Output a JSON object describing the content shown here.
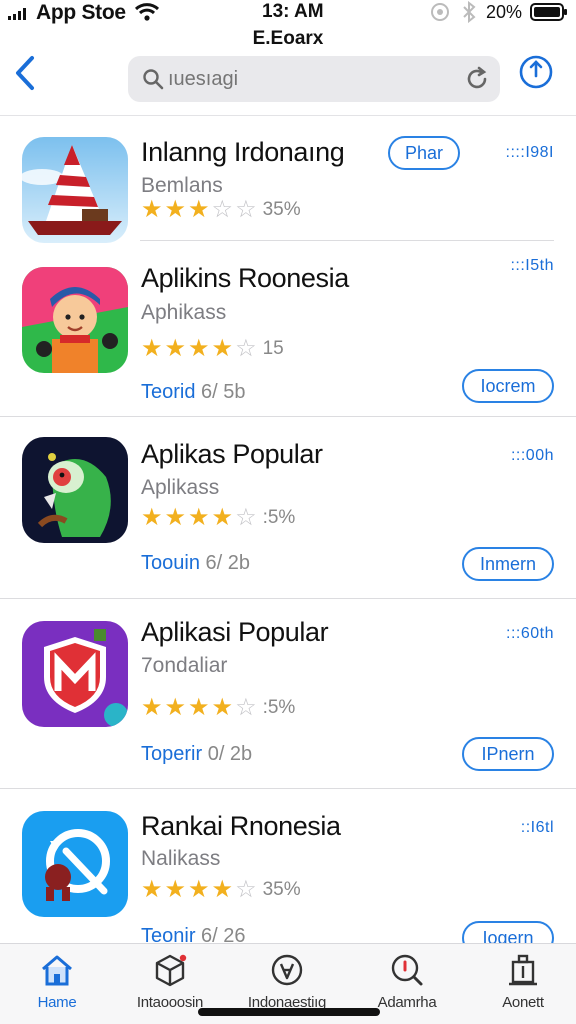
{
  "status": {
    "carrier": "App Stoe",
    "time": "13: AM",
    "battery_pct": "20%"
  },
  "header": {
    "title": "E.Eoarx"
  },
  "search": {
    "placeholder": "ıuesıagi"
  },
  "apps": [
    {
      "name": "Inlanng Irdonaıng",
      "subtitle": "Bemlans",
      "rating_text": "35%",
      "stars": 3,
      "size": "::::I98I",
      "action_label": "Phar",
      "meta": "",
      "meta_grey": ""
    },
    {
      "name": "Aplikins Roonesia",
      "subtitle": "Aphikass",
      "rating_text": "15",
      "stars": 4,
      "size": ":::I5th",
      "action_label": "Iocrem",
      "meta": "Teorid",
      "meta_grey": " 6/ 5b"
    },
    {
      "name": "Aplikas Popular",
      "subtitle": "Aplikass",
      "rating_text": ":5%",
      "stars": 4,
      "size": ":::00h",
      "action_label": "Inmern",
      "meta": "Toouin",
      "meta_grey": " 6/ 2b"
    },
    {
      "name": "Aplikasi Popular",
      "subtitle": "7ondaliar",
      "rating_text": ":5%",
      "stars": 4,
      "size": ":::60th",
      "action_label": "IPnern",
      "meta": "Toperir",
      "meta_grey": " 0/ 2b"
    },
    {
      "name": "Rankai Rnonesia",
      "subtitle": "Nalikass",
      "rating_text": "35%",
      "stars": 4,
      "size": "::I6tl",
      "action_label": "Iogern",
      "meta": "Teonir",
      "meta_grey": " 6/ 26"
    }
  ],
  "tabs": [
    {
      "label": "Hame",
      "icon": "home-icon",
      "active": true
    },
    {
      "label": "Intaooosin",
      "icon": "cube-icon"
    },
    {
      "label": "Indonaestiıg",
      "icon": "compass-icon"
    },
    {
      "label": "Adamrha",
      "icon": "search-badge-icon"
    },
    {
      "label": "Aonett",
      "icon": "tray-icon"
    }
  ],
  "colors": {
    "accent": "#1a6ed8",
    "star": "#f2b01e"
  }
}
